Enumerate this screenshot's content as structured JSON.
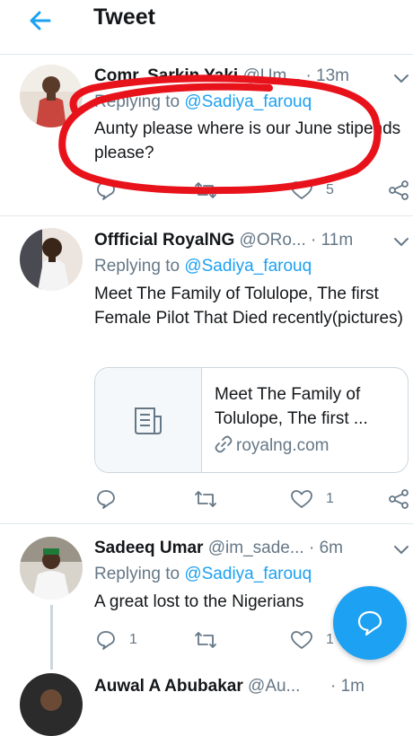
{
  "header": {
    "title": "Tweet"
  },
  "tweets": [
    {
      "name": "Comr. Sarkin Yaki",
      "handle": "@Um...",
      "dot": "·",
      "time": "13m",
      "replying_prefix": "Replying to ",
      "replying_to": "@Sadiya_farouq",
      "text": "Aunty please where is our June stipends please?",
      "likes": "5"
    },
    {
      "name": "Offficial RoyalNG",
      "handle": "@ORo...",
      "dot": "·",
      "time": "11m",
      "replying_prefix": "Replying to ",
      "replying_to": "@Sadiya_farouq",
      "text": "Meet The Family of Tolulope, The first Female Pilot That Died recently(pictures)",
      "card": {
        "title": "Meet The Family of Tolulope, The first ...",
        "domain": "royalng.com"
      },
      "likes": "1"
    },
    {
      "name": "Sadeeq Umar",
      "handle": "@im_sade...",
      "dot": "·",
      "time": "6m",
      "replying_prefix": "Replying to ",
      "replying_to": "@Sadiya_farouq",
      "text": "A great lost to the Nigerians",
      "replies": "1",
      "likes": "1"
    },
    {
      "name": "Auwal A Abubakar",
      "handle": "@Au...",
      "dot": "·",
      "time": "1m"
    }
  ],
  "colors": {
    "accent": "#1da1f2",
    "muted": "#657786",
    "annotation": "#e8121b"
  },
  "icons": [
    "back-arrow-icon",
    "chevron-down-icon",
    "reply-icon",
    "retweet-icon",
    "like-icon",
    "share-icon",
    "article-icon",
    "link-icon",
    "compose-reply-icon"
  ]
}
